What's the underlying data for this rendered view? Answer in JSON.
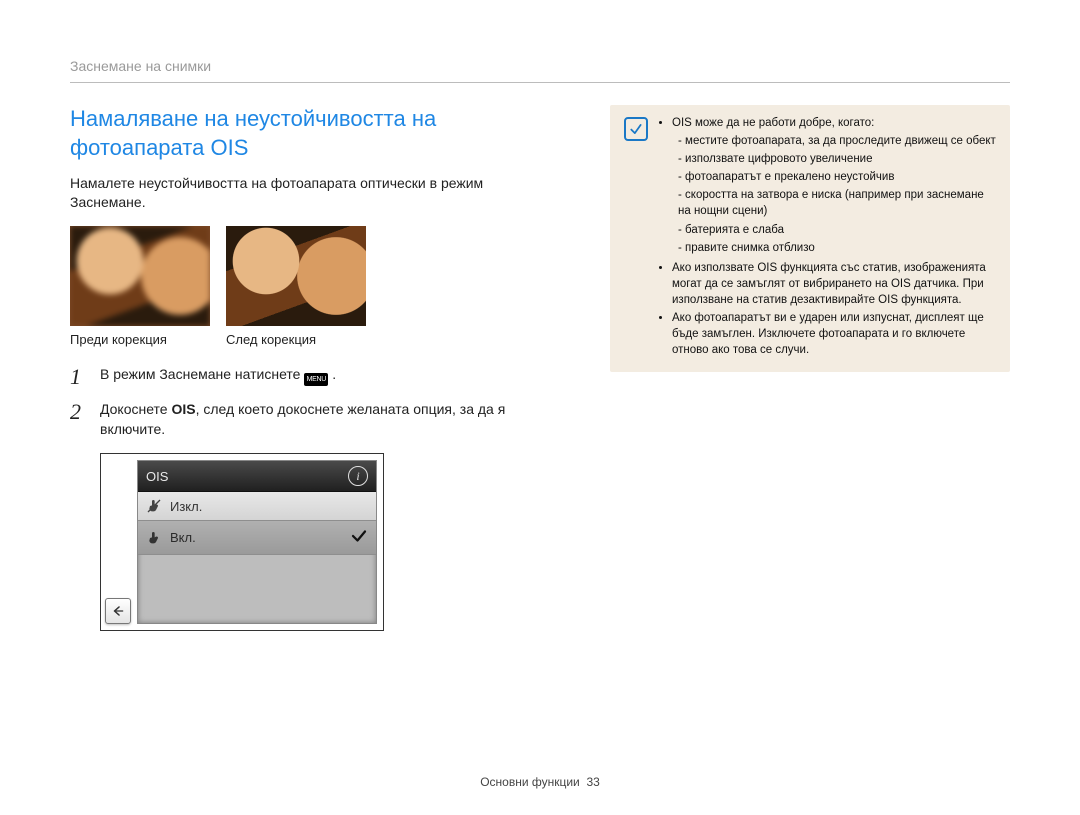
{
  "running_head": "Заснемане на снимки",
  "title": "Намаляване на неустойчивостта на фотоапарата OIS",
  "intro": "Намалете неустойчивостта на фотоапарата оптически в режим Заснемане.",
  "thumbs": {
    "before": "Преди корекция",
    "after": "След корекция"
  },
  "steps": {
    "s1_pre": "В режим Заснемане натиснете ",
    "s1_menu_chip": "MENU",
    "s1_post": " .",
    "s2_a": "Докоснете ",
    "s2_bold": "OIS",
    "s2_b": ", след което докоснете желаната опция, за да я включите."
  },
  "panel": {
    "title": "OIS",
    "off": "Изкл.",
    "on": "Вкл."
  },
  "note": {
    "b1": "OIS може да не работи добре, когато:",
    "b1_1": "местите фотоапарата, за да проследите движещ се обект",
    "b1_2": "използвате цифровото увеличение",
    "b1_3": "фотоапаратът е прекалено неустойчив",
    "b1_4": "скоростта на затвора е ниска (например при заснемане на нощни сцени)",
    "b1_5": "батерията е слаба",
    "b1_6": "правите снимка отблизо",
    "b2": "Ако използвате OIS функцията със статив, изображенията могат да се замъглят от вибрирането на OIS датчика. При използване на статив дезактивирайте OIS функцията.",
    "b3": "Ако фотоапаратът ви е ударен или изпуснат, дисплеят ще бъде замъглен. Изключете фотоапарата и го включете отново ако това се случи."
  },
  "footer": {
    "label": "Основни функции",
    "page": "33"
  }
}
